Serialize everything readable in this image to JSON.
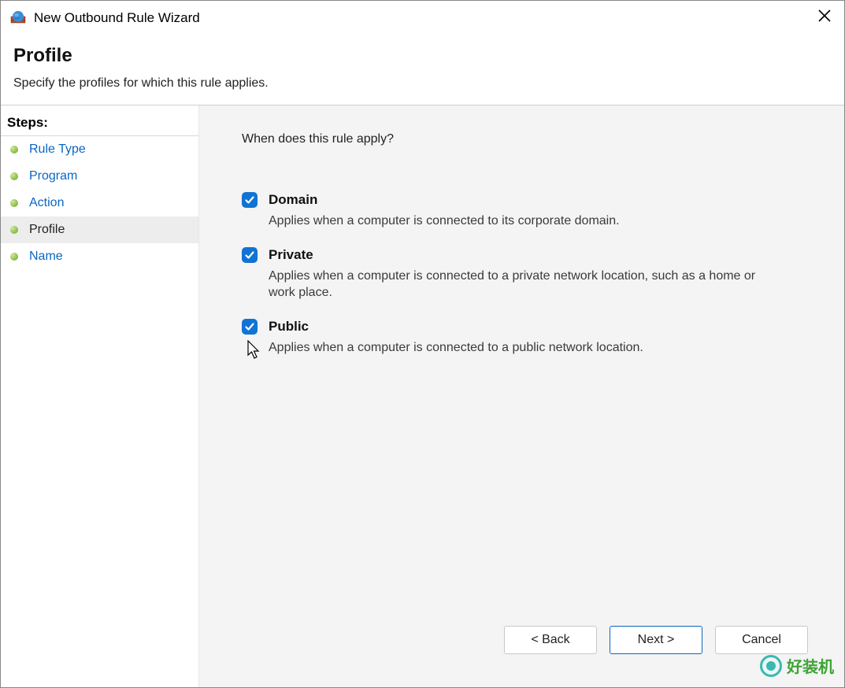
{
  "window": {
    "title": "New Outbound Rule Wizard"
  },
  "header": {
    "title": "Profile",
    "subtitle": "Specify the profiles for which this rule applies."
  },
  "sidebar": {
    "heading": "Steps:",
    "steps": [
      {
        "label": "Rule Type",
        "active": false
      },
      {
        "label": "Program",
        "active": false
      },
      {
        "label": "Action",
        "active": false
      },
      {
        "label": "Profile",
        "active": true
      },
      {
        "label": "Name",
        "active": false
      }
    ]
  },
  "main": {
    "question": "When does this rule apply?",
    "profiles": [
      {
        "name": "Domain",
        "desc": "Applies when a computer is connected to its corporate domain.",
        "checked": true
      },
      {
        "name": "Private",
        "desc": "Applies when a computer is connected to a private network location, such as a home or work place.",
        "checked": true
      },
      {
        "name": "Public",
        "desc": "Applies when a computer is connected to a public network location.",
        "checked": true
      }
    ]
  },
  "buttons": {
    "back": "< Back",
    "next": "Next >",
    "cancel": "Cancel"
  },
  "watermark": {
    "text": "好装机"
  }
}
